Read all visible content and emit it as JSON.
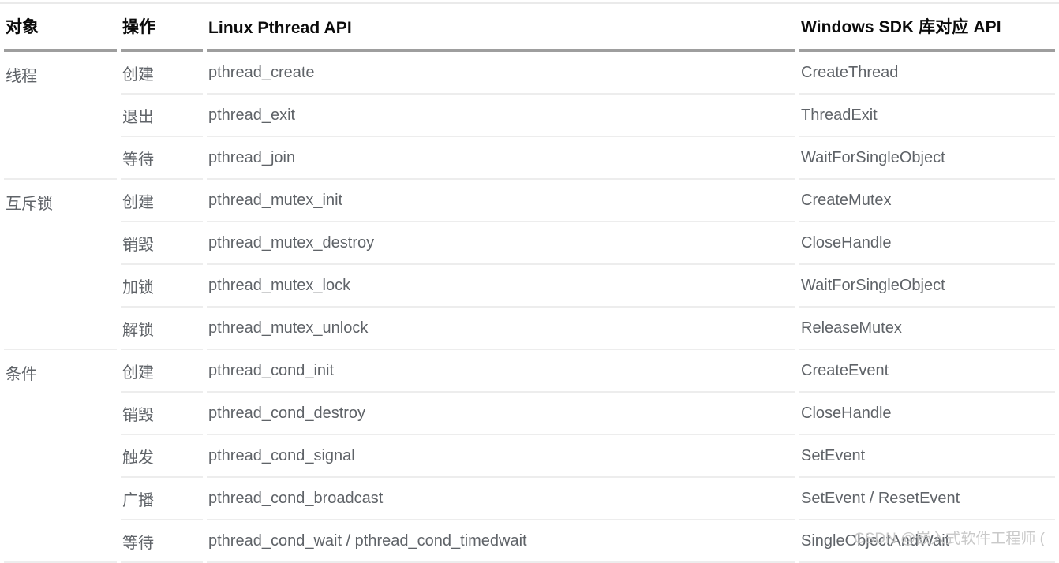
{
  "table": {
    "headers": {
      "object": "对象",
      "operation": "操作",
      "linux": "Linux Pthread API",
      "windows": "Windows SDK 库对应 API"
    },
    "groups": [
      {
        "object": "线程",
        "rows": [
          {
            "operation": "创建",
            "linux": "pthread_create",
            "windows": "CreateThread"
          },
          {
            "operation": "退出",
            "linux": "pthread_exit",
            "windows": "ThreadExit"
          },
          {
            "operation": "等待",
            "linux": "pthread_join",
            "windows": "WaitForSingleObject"
          }
        ]
      },
      {
        "object": "互斥锁",
        "rows": [
          {
            "operation": "创建",
            "linux": "pthread_mutex_init",
            "windows": "CreateMutex"
          },
          {
            "operation": "销毁",
            "linux": "pthread_mutex_destroy",
            "windows": "CloseHandle"
          },
          {
            "operation": "加锁",
            "linux": "pthread_mutex_lock",
            "windows": "WaitForSingleObject"
          },
          {
            "operation": "解锁",
            "linux": "pthread_mutex_unlock",
            "windows": "ReleaseMutex"
          }
        ]
      },
      {
        "object": "条件",
        "rows": [
          {
            "operation": "创建",
            "linux": "pthread_cond_init",
            "windows": "CreateEvent"
          },
          {
            "operation": "销毁",
            "linux": "pthread_cond_destroy",
            "windows": "CloseHandle"
          },
          {
            "operation": "触发",
            "linux": "pthread_cond_signal",
            "windows": "SetEvent"
          },
          {
            "operation": "广播",
            "linux": "pthread_cond_broadcast",
            "windows": "SetEvent / ResetEvent"
          },
          {
            "operation": "等待",
            "linux": "pthread_cond_wait / pthread_cond_timedwait",
            "windows": "SingleObjectAndWait"
          }
        ]
      }
    ]
  },
  "watermark": {
    "text": "CSDN @嵌入式软件工程师 ("
  },
  "colors": {
    "header_text": "#0b0b0b",
    "body_text": "#5f6368",
    "header_rule": "#9e9e9e",
    "row_rule": "#ededed",
    "watermark": "#c9c9c9",
    "background": "#ffffff"
  }
}
